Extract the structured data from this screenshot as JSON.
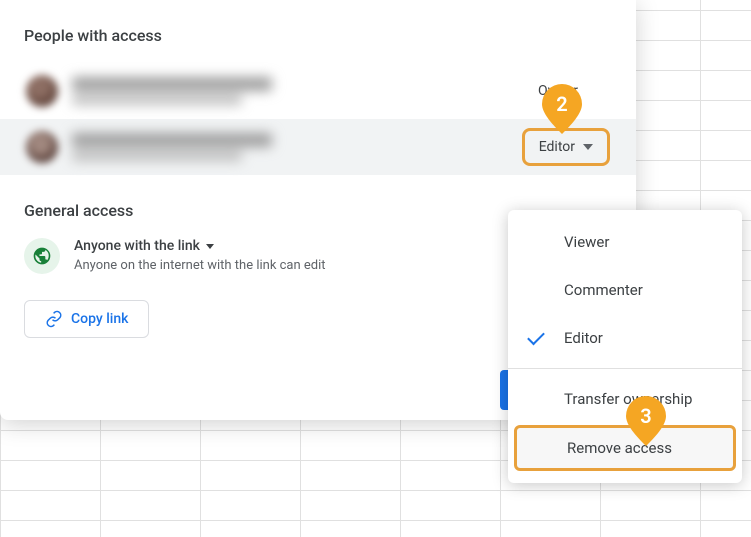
{
  "sections": {
    "people_title": "People with access",
    "general_title": "General access"
  },
  "people": [
    {
      "role": "Owner"
    },
    {
      "role": "Editor"
    }
  ],
  "general": {
    "option": "Anyone with the link",
    "description": "Anyone on the internet with the link can edit"
  },
  "copy_link_label": "Copy link",
  "menu": {
    "viewer": "Viewer",
    "commenter": "Commenter",
    "editor": "Editor",
    "transfer": "Transfer ownership",
    "remove": "Remove access",
    "selected": "Editor"
  },
  "callouts": {
    "step2": "2",
    "step3": "3"
  },
  "colors": {
    "accent": "#1a73e8",
    "highlight": "#e8a13c"
  }
}
